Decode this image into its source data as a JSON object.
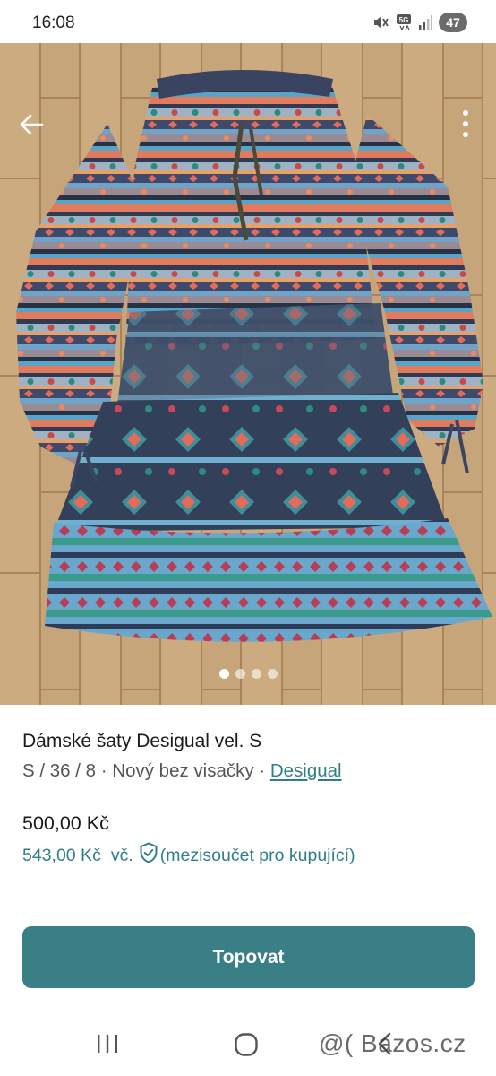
{
  "status_bar": {
    "time": "16:08",
    "network": "5G",
    "battery": "47",
    "icons": [
      "mute-icon",
      "network-5g-icon",
      "signal-icon"
    ]
  },
  "listing": {
    "title": "Dámské šaty Desigual vel. S",
    "meta_prefix": "S / 36 / 8 · Nový bez visačky · ",
    "brand": "Desigual",
    "price": "500,00 Kč",
    "buyer_price": "543,00 Kč",
    "buyer_prefix": "vč.",
    "buyer_note": "(mezisoučet pro kupující)",
    "action_label": "Topovat"
  },
  "gallery": {
    "count": 4,
    "active": 1
  },
  "watermark": "@( Bazos.cz",
  "colors": {
    "accent": "#3b7f86",
    "link": "#2f7f86"
  }
}
